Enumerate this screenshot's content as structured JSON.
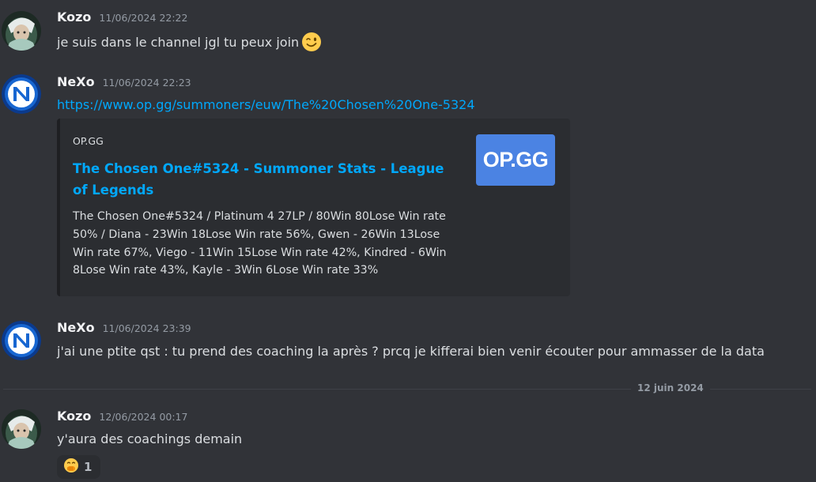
{
  "messages": [
    {
      "username": "Kozo",
      "timestamp": "11/06/2024 22:22",
      "text": "je suis dans le channel jgl tu peux join",
      "emoji": "winking-face"
    },
    {
      "username": "NeXo",
      "timestamp": "11/06/2024 22:23",
      "link": "https://www.op.gg/summoners/euw/The%20Chosen%20One-5324",
      "embed": {
        "provider": "OP.GG",
        "title": "The Chosen One#5324 - Summoner Stats - League of Legends",
        "description": "The Chosen One#5324 / Platinum 4 27LP / 80Win 80Lose Win rate 50% / Diana - 23Win 18Lose Win rate 56%, Gwen - 26Win 13Lose Win rate 67%, Viego - 11Win 15Lose Win rate 42%, Kindred - 6Win 8Lose Win rate 43%, Kayle - 3Win 6Lose Win rate 33%",
        "thumbnail_text": "OP.GG"
      }
    },
    {
      "username": "NeXo",
      "timestamp": "11/06/2024 23:39",
      "text": "j'ai une ptite qst : tu prend des coaching la après ? prcq je kifferai bien venir écouter pour ammasser de la data"
    },
    {
      "username": "Kozo",
      "timestamp": "12/06/2024 00:17",
      "text": "y'aura des coachings demain",
      "reaction": {
        "emoji": "face-with-hand-over-mouth",
        "count": "1"
      }
    }
  ],
  "date_divider": "12 juin 2024",
  "colors": {
    "background": "#313338",
    "link": "#00a8fc",
    "embed_background": "#2b2d31",
    "opgg_brand": "#4b83e3"
  }
}
